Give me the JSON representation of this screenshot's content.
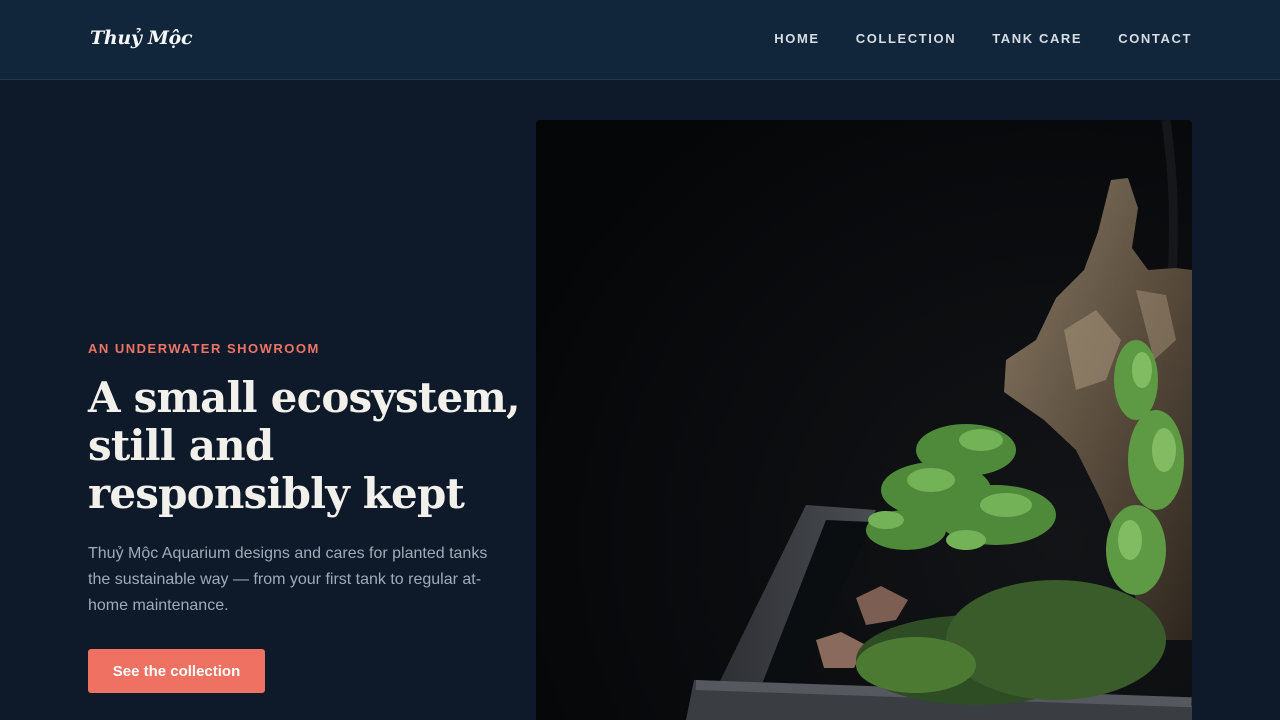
{
  "header": {
    "logo": "Thuỷ Mộc",
    "nav": [
      {
        "label": "HOME"
      },
      {
        "label": "COLLECTION"
      },
      {
        "label": "TANK CARE"
      },
      {
        "label": "CONTACT"
      }
    ]
  },
  "hero": {
    "eyebrow": "AN UNDERWATER SHOWROOM",
    "headline": "A small ecosystem, still and responsibly kept",
    "lede": "Thuỷ Mộc Aquarium designs and cares for planted tanks the sustainable way — from your first tank to regular at-home maintenance.",
    "cta_label": "See the collection"
  },
  "colors": {
    "background": "#0e1a29",
    "header": "#11263a",
    "accent": "#ee7162",
    "headline": "#f2f0ea",
    "body_text": "#9eabb8"
  }
}
